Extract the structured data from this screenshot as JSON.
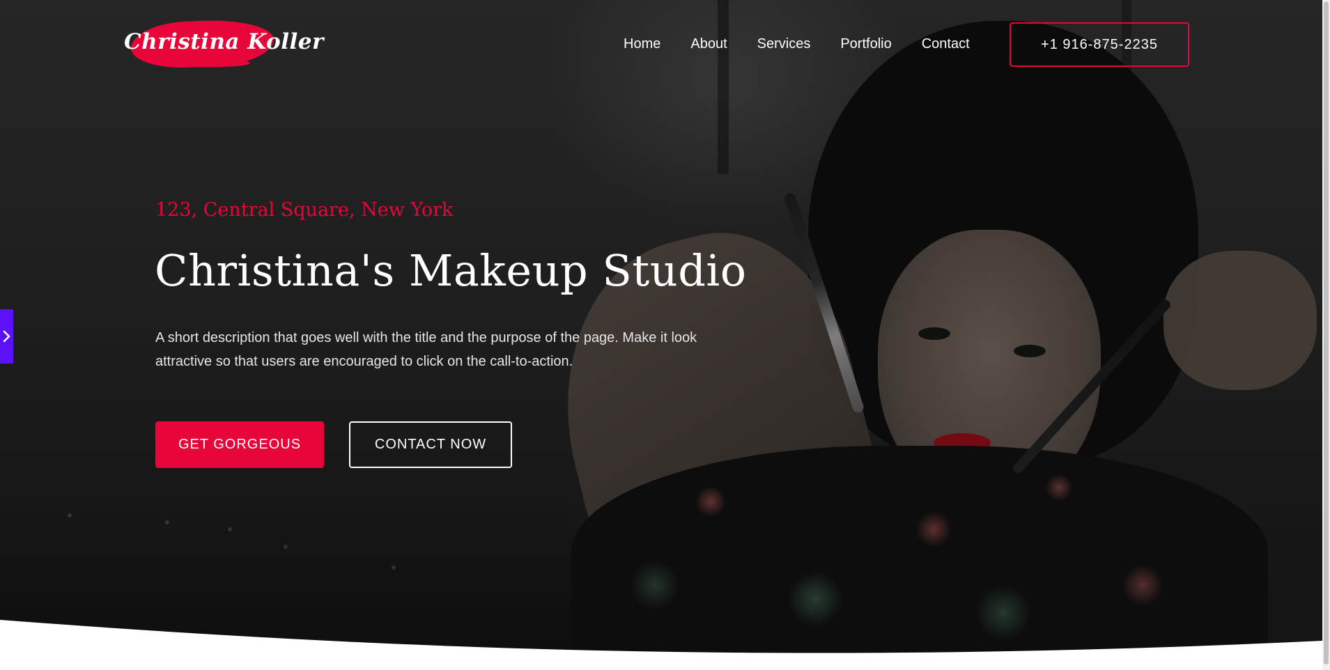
{
  "header": {
    "logo_text": "Christina Koller",
    "nav": [
      "Home",
      "About",
      "Services",
      "Portfolio",
      "Contact"
    ],
    "phone": "+1 916-875-2235"
  },
  "hero": {
    "address": "123, Central Square, New York",
    "title": "Christina's Makeup Studio",
    "description": "A short description that goes well with the title and the purpose of the page. Make it look attractive so that users are encouraged to click on the call-to-action.",
    "primary_cta": "GET GORGEOUS",
    "secondary_cta": "CONTACT NOW"
  },
  "side_tab": {
    "icon": "chevron-right-icon"
  },
  "colors": {
    "accent": "#e8053a",
    "side_tab": "#5b10f5",
    "overlay": "#262626"
  }
}
